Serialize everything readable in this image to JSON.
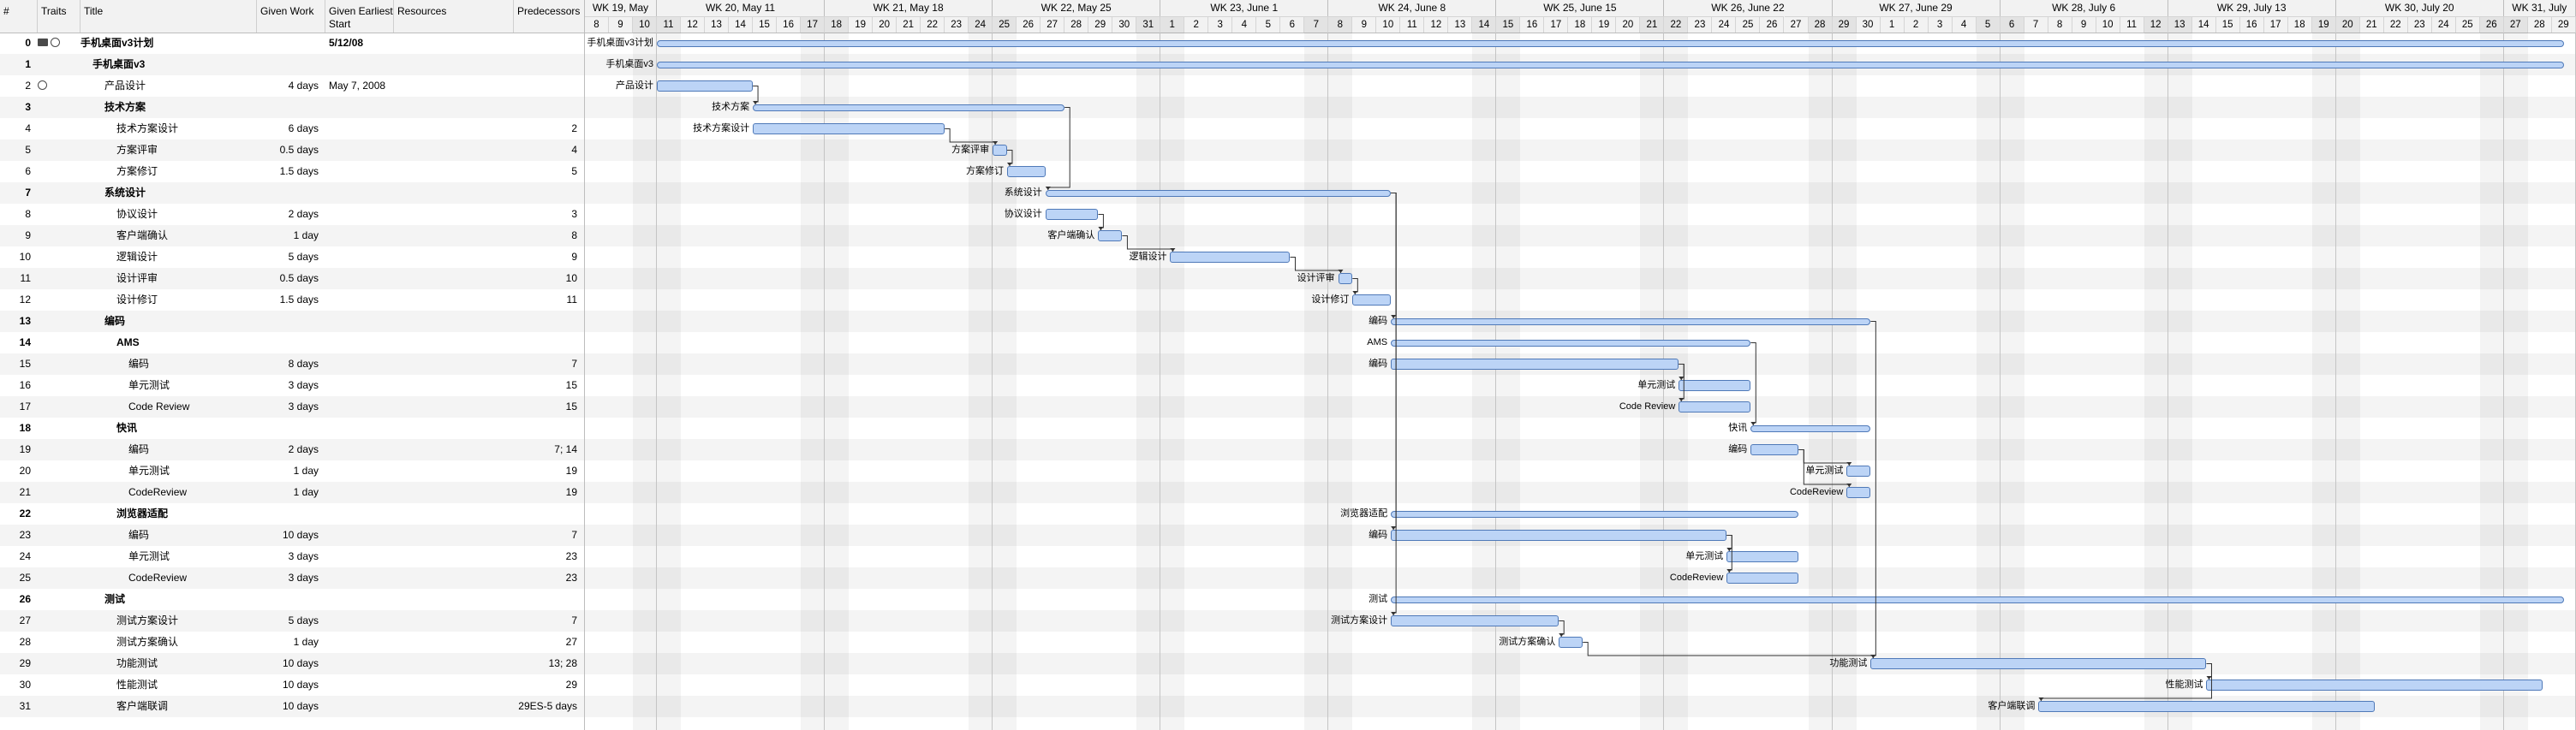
{
  "columns": {
    "num": "#",
    "traits": "Traits",
    "title": "Title",
    "given_work": "Given Work",
    "given_start": "Given Earliest Start",
    "resources": "Resources",
    "predecessors": "Predecessors"
  },
  "weeks": [
    {
      "label": "WK 19, May",
      "start": 0,
      "days": 3
    },
    {
      "label": "WK 20, May 11",
      "start": 3,
      "days": 7
    },
    {
      "label": "WK 21, May 18",
      "start": 10,
      "days": 7
    },
    {
      "label": "WK 22, May 25",
      "start": 17,
      "days": 7
    },
    {
      "label": "WK 23, June 1",
      "start": 24,
      "days": 7
    },
    {
      "label": "WK 24, June 8",
      "start": 31,
      "days": 7
    },
    {
      "label": "WK 25, June 15",
      "start": 38,
      "days": 7
    },
    {
      "label": "WK 26, June 22",
      "start": 45,
      "days": 7
    },
    {
      "label": "WK 27, June 29",
      "start": 52,
      "days": 7
    },
    {
      "label": "WK 28, July 6",
      "start": 59,
      "days": 7
    },
    {
      "label": "WK 29, July 13",
      "start": 66,
      "days": 7
    },
    {
      "label": "WK 30, July 20",
      "start": 73,
      "days": 7
    },
    {
      "label": "WK 31, July",
      "start": 80,
      "days": 3
    }
  ],
  "days": [
    "8",
    "9",
    "10",
    "11",
    "12",
    "13",
    "14",
    "15",
    "16",
    "17",
    "18",
    "19",
    "20",
    "21",
    "22",
    "23",
    "24",
    "25",
    "26",
    "27",
    "28",
    "29",
    "30",
    "31",
    "1",
    "2",
    "3",
    "4",
    "5",
    "6",
    "7",
    "8",
    "9",
    "10",
    "11",
    "12",
    "13",
    "14",
    "15",
    "16",
    "17",
    "18",
    "19",
    "20",
    "21",
    "22",
    "23",
    "24",
    "25",
    "26",
    "27",
    "28",
    "29",
    "30",
    "1",
    "2",
    "3",
    "4",
    "5",
    "6",
    "7",
    "8",
    "9",
    "10",
    "11",
    "12",
    "13",
    "14",
    "15",
    "16",
    "17",
    "18",
    "19",
    "20",
    "21",
    "22",
    "23",
    "24",
    "25",
    "26",
    "27",
    "28",
    "29"
  ],
  "tasks": [
    {
      "num": "0",
      "title": "手机桌面v3计划",
      "work": "",
      "start": "5/12/08",
      "pred": "",
      "level": 0,
      "bold": true,
      "icons": [
        "folder-icon",
        "clock-icon"
      ],
      "type": "summary",
      "bar_start": 3.0,
      "bar_end": 82.5,
      "label": "手机桌面v3计划"
    },
    {
      "num": "1",
      "title": "手机桌面v3",
      "work": "",
      "start": "",
      "pred": "",
      "level": 1,
      "bold": true,
      "icons": [],
      "type": "summary",
      "bar_start": 3.0,
      "bar_end": 82.5,
      "label": "手机桌面v3"
    },
    {
      "num": "2",
      "title": "产品设计",
      "work": "4 days",
      "start": "May 7, 2008",
      "pred": "",
      "level": 2,
      "bold": false,
      "icons": [
        "clock-icon"
      ],
      "type": "task",
      "bar_start": 3.0,
      "bar_end": 7.0,
      "label": "产品设计"
    },
    {
      "num": "3",
      "title": "技术方案",
      "work": "",
      "start": "",
      "pred": "",
      "level": 2,
      "bold": true,
      "icons": [],
      "type": "summary",
      "bar_start": 7.0,
      "bar_end": 20.0,
      "label": "技术方案"
    },
    {
      "num": "4",
      "title": "技术方案设计",
      "work": "6 days",
      "start": "",
      "pred": "2",
      "level": 3,
      "bold": false,
      "icons": [],
      "type": "task",
      "bar_start": 7.0,
      "bar_end": 15.0,
      "label": "技术方案设计"
    },
    {
      "num": "5",
      "title": "方案评审",
      "work": "0.5 days",
      "start": "",
      "pred": "4",
      "level": 3,
      "bold": false,
      "icons": [],
      "type": "task",
      "bar_start": 17.0,
      "bar_end": 17.6,
      "label": "方案评审"
    },
    {
      "num": "6",
      "title": "方案修订",
      "work": "1.5 days",
      "start": "",
      "pred": "5",
      "level": 3,
      "bold": false,
      "icons": [],
      "type": "task",
      "bar_start": 17.6,
      "bar_end": 19.2,
      "label": "方案修订"
    },
    {
      "num": "7",
      "title": "系统设计",
      "work": "",
      "start": "",
      "pred": "",
      "level": 2,
      "bold": true,
      "icons": [],
      "type": "summary",
      "bar_start": 19.2,
      "bar_end": 33.6,
      "label": "系统设计"
    },
    {
      "num": "8",
      "title": "协议设计",
      "work": "2 days",
      "start": "",
      "pred": "3",
      "level": 3,
      "bold": false,
      "icons": [],
      "type": "task",
      "bar_start": 19.2,
      "bar_end": 21.4,
      "label": "协议设计"
    },
    {
      "num": "9",
      "title": "客户端确认",
      "work": "1 day",
      "start": "",
      "pred": "8",
      "level": 3,
      "bold": false,
      "icons": [],
      "type": "task",
      "bar_start": 21.4,
      "bar_end": 22.4,
      "label": "客户端确认"
    },
    {
      "num": "10",
      "title": "逻辑设计",
      "work": "5 days",
      "start": "",
      "pred": "9",
      "level": 3,
      "bold": false,
      "icons": [],
      "type": "task",
      "bar_start": 24.4,
      "bar_end": 29.4,
      "label": "逻辑设计"
    },
    {
      "num": "11",
      "title": "设计评审",
      "work": "0.5 days",
      "start": "",
      "pred": "10",
      "level": 3,
      "bold": false,
      "icons": [],
      "type": "task",
      "bar_start": 31.4,
      "bar_end": 32.0,
      "label": "设计评审"
    },
    {
      "num": "12",
      "title": "设计修订",
      "work": "1.5 days",
      "start": "",
      "pred": "11",
      "level": 3,
      "bold": false,
      "icons": [],
      "type": "task",
      "bar_start": 32.0,
      "bar_end": 33.6,
      "label": "设计修订"
    },
    {
      "num": "13",
      "title": "编码",
      "work": "",
      "start": "",
      "pred": "",
      "level": 2,
      "bold": true,
      "icons": [],
      "type": "summary",
      "bar_start": 33.6,
      "bar_end": 53.6,
      "label": "编码"
    },
    {
      "num": "14",
      "title": "AMS",
      "work": "",
      "start": "",
      "pred": "",
      "level": 3,
      "bold": true,
      "icons": [],
      "type": "summary",
      "bar_start": 33.6,
      "bar_end": 48.6,
      "label": "AMS"
    },
    {
      "num": "15",
      "title": "编码",
      "work": "8 days",
      "start": "",
      "pred": "7",
      "level": 4,
      "bold": false,
      "icons": [],
      "type": "task",
      "bar_start": 33.6,
      "bar_end": 45.6,
      "label": "编码"
    },
    {
      "num": "16",
      "title": "单元测试",
      "work": "3 days",
      "start": "",
      "pred": "15",
      "level": 4,
      "bold": false,
      "icons": [],
      "type": "task",
      "bar_start": 45.6,
      "bar_end": 48.6,
      "label": "单元测试"
    },
    {
      "num": "17",
      "title": "Code Review",
      "work": "3 days",
      "start": "",
      "pred": "15",
      "level": 4,
      "bold": false,
      "icons": [],
      "type": "task",
      "bar_start": 45.6,
      "bar_end": 48.6,
      "label": "Code Review"
    },
    {
      "num": "18",
      "title": "快讯",
      "work": "",
      "start": "",
      "pred": "",
      "level": 3,
      "bold": true,
      "icons": [],
      "type": "summary",
      "bar_start": 48.6,
      "bar_end": 53.6,
      "label": "快讯"
    },
    {
      "num": "19",
      "title": "编码",
      "work": "2 days",
      "start": "",
      "pred": "7; 14",
      "level": 4,
      "bold": false,
      "icons": [],
      "type": "task",
      "bar_start": 48.6,
      "bar_end": 50.6,
      "label": "编码"
    },
    {
      "num": "20",
      "title": "单元测试",
      "work": "1 day",
      "start": "",
      "pred": "19",
      "level": 4,
      "bold": false,
      "icons": [],
      "type": "task",
      "bar_start": 52.6,
      "bar_end": 53.6,
      "label": "单元测试"
    },
    {
      "num": "21",
      "title": "CodeReview",
      "work": "1 day",
      "start": "",
      "pred": "19",
      "level": 4,
      "bold": false,
      "icons": [],
      "type": "task",
      "bar_start": 52.6,
      "bar_end": 53.6,
      "label": "CodeReview"
    },
    {
      "num": "22",
      "title": "浏览器适配",
      "work": "",
      "start": "",
      "pred": "",
      "level": 3,
      "bold": true,
      "icons": [],
      "type": "summary",
      "bar_start": 33.6,
      "bar_end": 50.6,
      "label": "浏览器适配"
    },
    {
      "num": "23",
      "title": "编码",
      "work": "10 days",
      "start": "",
      "pred": "7",
      "level": 4,
      "bold": false,
      "icons": [],
      "type": "task",
      "bar_start": 33.6,
      "bar_end": 47.6,
      "label": "编码"
    },
    {
      "num": "24",
      "title": "单元测试",
      "work": "3 days",
      "start": "",
      "pred": "23",
      "level": 4,
      "bold": false,
      "icons": [],
      "type": "task",
      "bar_start": 47.6,
      "bar_end": 50.6,
      "label": "单元测试"
    },
    {
      "num": "25",
      "title": "CodeReview",
      "work": "3 days",
      "start": "",
      "pred": "23",
      "level": 4,
      "bold": false,
      "icons": [],
      "type": "task",
      "bar_start": 47.6,
      "bar_end": 50.6,
      "label": "CodeReview"
    },
    {
      "num": "26",
      "title": "测试",
      "work": "",
      "start": "",
      "pred": "",
      "level": 2,
      "bold": true,
      "icons": [],
      "type": "summary",
      "bar_start": 33.6,
      "bar_end": 82.5,
      "label": "测试"
    },
    {
      "num": "27",
      "title": "测试方案设计",
      "work": "5 days",
      "start": "",
      "pred": "7",
      "level": 3,
      "bold": false,
      "icons": [],
      "type": "task",
      "bar_start": 33.6,
      "bar_end": 40.6,
      "label": "测试方案设计"
    },
    {
      "num": "28",
      "title": "测试方案确认",
      "work": "1 day",
      "start": "",
      "pred": "27",
      "level": 3,
      "bold": false,
      "icons": [],
      "type": "task",
      "bar_start": 40.6,
      "bar_end": 41.6,
      "label": "测试方案确认"
    },
    {
      "num": "29",
      "title": "功能测试",
      "work": "10 days",
      "start": "",
      "pred": "13; 28",
      "level": 3,
      "bold": false,
      "icons": [],
      "type": "task",
      "bar_start": 53.6,
      "bar_end": 67.6,
      "label": "功能测试"
    },
    {
      "num": "30",
      "title": "性能测试",
      "work": "10 days",
      "start": "",
      "pred": "29",
      "level": 3,
      "bold": false,
      "icons": [],
      "type": "task",
      "bar_start": 67.6,
      "bar_end": 81.6,
      "label": "性能测试"
    },
    {
      "num": "31",
      "title": "客户端联调",
      "work": "10 days",
      "start": "",
      "pred": "29ES-5 days",
      "level": 3,
      "bold": false,
      "icons": [],
      "type": "task",
      "bar_start": 60.6,
      "bar_end": 74.6,
      "label": "客户端联调"
    }
  ],
  "links": [
    [
      2,
      3
    ],
    [
      4,
      5
    ],
    [
      5,
      6
    ],
    [
      3,
      7
    ],
    [
      8,
      9
    ],
    [
      9,
      10
    ],
    [
      10,
      11
    ],
    [
      11,
      12
    ],
    [
      7,
      13
    ],
    [
      15,
      16
    ],
    [
      15,
      17
    ],
    [
      14,
      18
    ],
    [
      19,
      20
    ],
    [
      19,
      21
    ],
    [
      7,
      23
    ],
    [
      23,
      24
    ],
    [
      23,
      25
    ],
    [
      7,
      27
    ],
    [
      27,
      28
    ],
    [
      28,
      29
    ],
    [
      13,
      29
    ],
    [
      29,
      30
    ],
    [
      29,
      31
    ]
  ],
  "colors": {
    "bar_fill": "#bcd4f6",
    "bar_stroke": "#4f79b8",
    "link": "#333333",
    "weekend": "#e3e3e3"
  }
}
